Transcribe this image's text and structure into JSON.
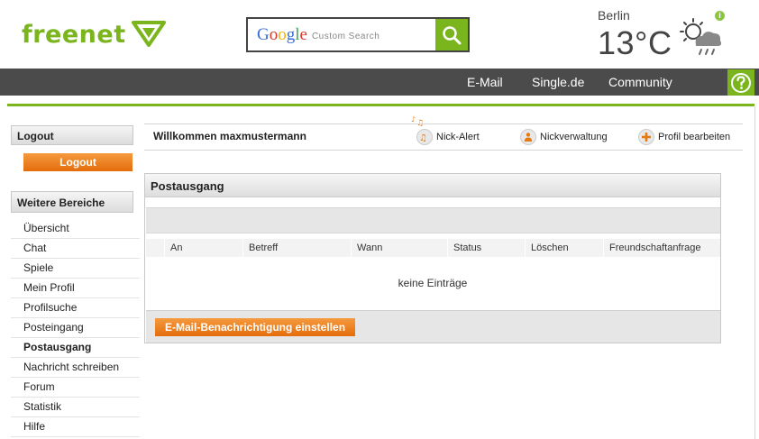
{
  "header": {
    "logo_text": "freenet",
    "search": {
      "brand": "Google",
      "placeholder": "Custom Search"
    },
    "weather": {
      "city": "Berlin",
      "temperature": "13°C",
      "icon": "sun-cloud-rain-icon"
    }
  },
  "nav": {
    "items": [
      "E-Mail",
      "Single.de",
      "Community"
    ],
    "help_icon": "question-icon"
  },
  "sidebar": {
    "logout_heading": "Logout",
    "logout_button": "Logout",
    "more_heading": "Weitere Bereiche",
    "items": [
      "Übersicht",
      "Chat",
      "Spiele",
      "Mein Profil",
      "Profilsuche",
      "Posteingang",
      "Postausgang",
      "Nachricht schreiben",
      "Forum",
      "Statistik",
      "Hilfe"
    ],
    "active_item": "Postausgang"
  },
  "welcome": {
    "text": "Willkommen maxmustermann",
    "actions": [
      "Nick-Alert",
      "Nickverwaltung",
      "Profil bearbeiten"
    ]
  },
  "panel": {
    "title": "Postausgang",
    "columns": [
      "An",
      "Betreff",
      "Wann",
      "Status",
      "Löschen",
      "Freundschaftanfrage"
    ],
    "empty_text": "keine Einträge",
    "notify_button": "E-Mail-Benachrichtigung einstellen"
  },
  "colors": {
    "brand_green": "#7ab51d",
    "accent_orange": "#e46d0c",
    "nav_bg": "#4b4b4b"
  }
}
